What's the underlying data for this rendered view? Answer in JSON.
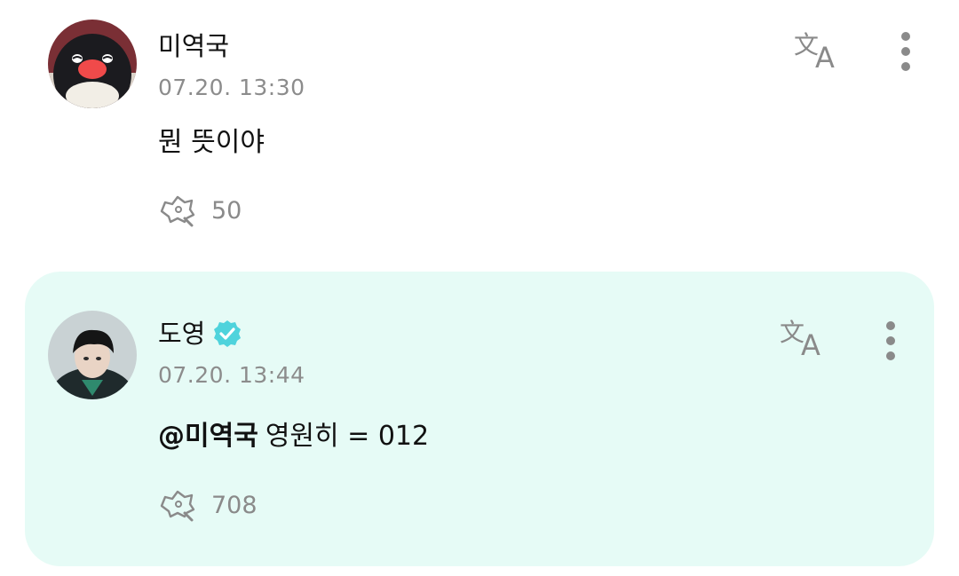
{
  "comments": [
    {
      "username": "미역국",
      "verified": false,
      "timestamp": "07.20. 13:30",
      "text": "뭔 뜻이야",
      "likes": "50",
      "avatar_icon": "penguin-avatar",
      "translate_icon": "translate-icon",
      "more_icon": "more-vertical-icon"
    },
    {
      "username": "도영",
      "verified": true,
      "timestamp": "07.20. 13:44",
      "mention": "@미역국",
      "text": "영원히 = 012",
      "likes": "708",
      "avatar_icon": "person-avatar",
      "translate_icon": "translate-icon",
      "more_icon": "more-vertical-icon",
      "highlight_color": "#e6fbf6",
      "verified_color": "#4fd3dc"
    }
  ]
}
